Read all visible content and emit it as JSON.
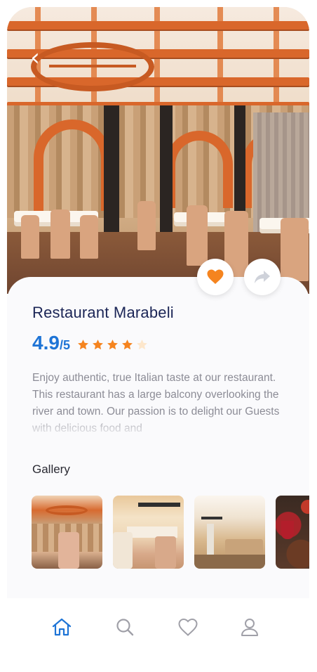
{
  "restaurant": {
    "name": "Restaurant Marabeli",
    "rating": {
      "value": "4.9",
      "scale": "/5",
      "stars": 4,
      "max_stars": 5
    },
    "description": "Enjoy authentic, true Italian taste at our restaurant. This restaurant has a large balcony overlooking the river and town. Our passion is to delight our Guests with delicious food and"
  },
  "gallery": {
    "title": "Gallery",
    "items": [
      {
        "icon": "restaurant-hall-photo"
      },
      {
        "icon": "banquet-hall-photo"
      },
      {
        "icon": "dining-room-photo"
      },
      {
        "icon": "food-and-wine-photo"
      }
    ]
  },
  "actions": {
    "favorite_icon": "heart-icon",
    "share_icon": "share-icon",
    "back_icon": "chevron-left-icon"
  },
  "nav": {
    "items": [
      {
        "icon": "home-icon",
        "active": true
      },
      {
        "icon": "search-icon",
        "active": false
      },
      {
        "icon": "heart-icon",
        "active": false
      },
      {
        "icon": "user-icon",
        "active": false
      }
    ]
  },
  "colors": {
    "accent_blue": "#1e74d6",
    "title_navy": "#1b2556",
    "star_orange": "#f5841f",
    "star_empty": "#fde7cc",
    "muted_text": "#8c8c96",
    "nav_inactive": "#a0a0a8"
  }
}
